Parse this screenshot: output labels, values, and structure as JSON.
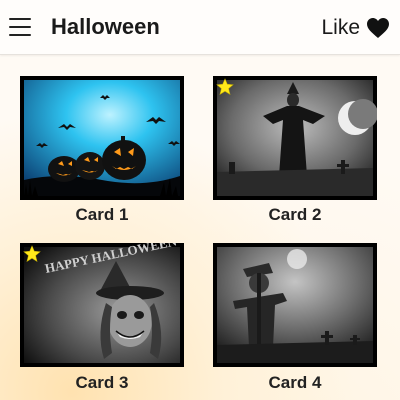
{
  "header": {
    "title": "Halloween",
    "menu_icon": "hamburger-menu-icon",
    "like_label": "Like",
    "like_icon": "heart-icon"
  },
  "cards": [
    {
      "label": "Card 1",
      "starred": false,
      "image": "pumpkins-bats-blue-sky"
    },
    {
      "label": "Card 2",
      "starred": true,
      "image": "witch-crescent-moon-graveyard"
    },
    {
      "label": "Card 3",
      "starred": true,
      "image": "happy-halloween-witch-face",
      "image_text": "HAPPY HALLOWEEN"
    },
    {
      "label": "Card 4",
      "starred": true,
      "image": "scarecrow-graveyard-night"
    }
  ],
  "colors": {
    "star": "#ffe81a",
    "card1_sky": "#2ec3f0",
    "text": "#222222"
  }
}
